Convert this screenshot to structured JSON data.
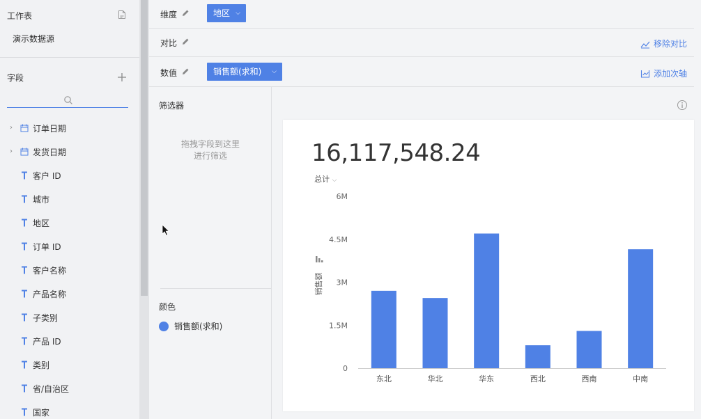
{
  "sidebar": {
    "worksheet_title": "工作表",
    "data_source": "演示数据源",
    "fields_title": "字段",
    "fields": [
      {
        "label": "订单日期",
        "type": "date",
        "expandable": true
      },
      {
        "label": "发货日期",
        "type": "date",
        "expandable": true
      },
      {
        "label": "客户 ID",
        "type": "text"
      },
      {
        "label": "城市",
        "type": "text"
      },
      {
        "label": "地区",
        "type": "text"
      },
      {
        "label": "订单 ID",
        "type": "text"
      },
      {
        "label": "客户名称",
        "type": "text"
      },
      {
        "label": "产品名称",
        "type": "text"
      },
      {
        "label": "子类别",
        "type": "text"
      },
      {
        "label": "产品 ID",
        "type": "text"
      },
      {
        "label": "类别",
        "type": "text"
      },
      {
        "label": "省/自治区",
        "type": "text"
      },
      {
        "label": "国家",
        "type": "text"
      }
    ]
  },
  "config": {
    "dimension_label": "维度",
    "dimension_pill": "地区",
    "compare_label": "对比",
    "remove_compare": "移除对比",
    "value_label": "数值",
    "value_pill": "销售额(求和)",
    "add_secondary_axis": "添加次轴"
  },
  "filter_panel": {
    "title": "筛选器",
    "hint_line1": "拖拽字段到这里",
    "hint_line2": "进行筛选",
    "color_title": "颜色",
    "legend_label": "销售额(求和)"
  },
  "chart": {
    "total_value": "16,117,548.24",
    "aggregate_label": "总计"
  },
  "colors": {
    "accent": "#4f81e5",
    "bar": "#4f81e5"
  },
  "chart_data": {
    "type": "bar",
    "categories": [
      "东北",
      "华北",
      "华东",
      "西北",
      "西南",
      "中南"
    ],
    "series": [
      {
        "values": [
          2700000,
          2450000,
          4700000,
          800000,
          1300000,
          4150000
        ]
      }
    ],
    "ylabel": "销售额",
    "xlabel": "",
    "ylim": [
      0,
      6000000
    ],
    "yticks": [
      0,
      1500000,
      3000000,
      4500000,
      6000000
    ],
    "ytick_labels": [
      "0",
      "1.5M",
      "3M",
      "4.5M",
      "6M"
    ],
    "grid": false,
    "legend": "left-panel"
  }
}
